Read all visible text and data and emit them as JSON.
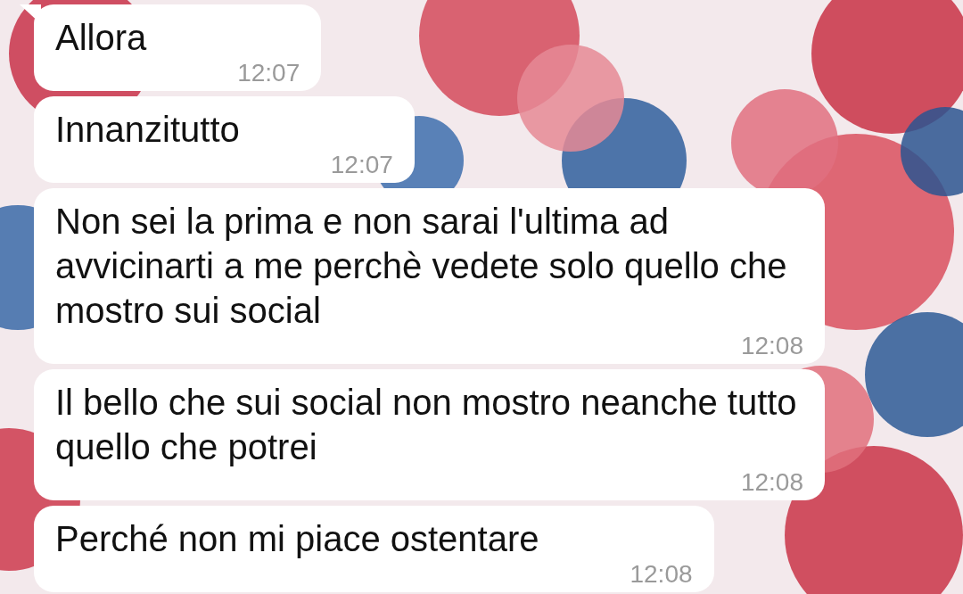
{
  "messages": [
    {
      "text": "Allora",
      "time": "12:07",
      "tail": true
    },
    {
      "text": "Innanzitutto",
      "time": "12:07",
      "tail": false
    },
    {
      "text": "Non sei la prima e non sarai l'ultima ad avvicinarti a me perchè vedete solo quello che mostro sui social",
      "time": "12:08",
      "tail": false
    },
    {
      "text": "Il bello che sui social non mostro neanche tutto quello che potrei",
      "time": "12:08",
      "tail": false
    },
    {
      "text": "Perché non mi piace ostentare",
      "time": "12:08",
      "tail": false
    }
  ]
}
